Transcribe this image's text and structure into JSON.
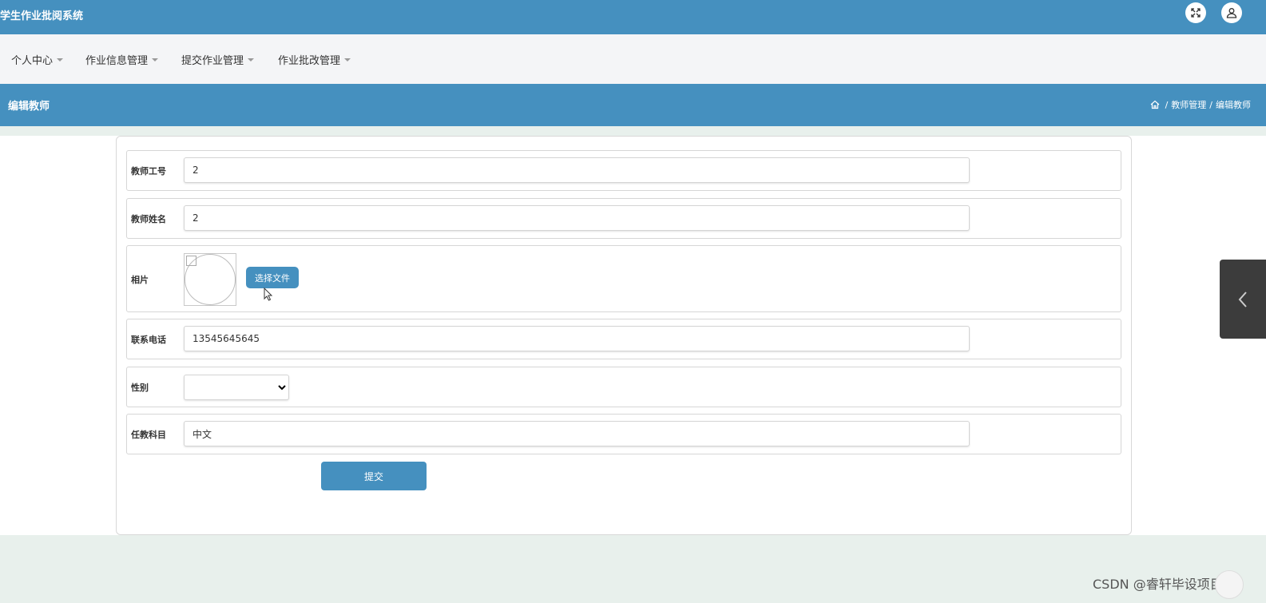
{
  "header": {
    "app_title": "学生作业批阅系统",
    "icons": [
      "fullscreen-icon",
      "user-icon"
    ]
  },
  "nav": {
    "items": [
      {
        "label": "个人中心"
      },
      {
        "label": "作业信息管理"
      },
      {
        "label": "提交作业管理"
      },
      {
        "label": "作业批改管理"
      }
    ]
  },
  "page": {
    "title": "编辑教师",
    "breadcrumb": [
      "教师管理",
      "编辑教师"
    ],
    "breadcrumb_separator": "/"
  },
  "form": {
    "teacher_id": {
      "label": "教师工号",
      "value": "2"
    },
    "teacher_name": {
      "label": "教师姓名",
      "value": "2"
    },
    "photo": {
      "label": "相片",
      "button_label": "选择文件"
    },
    "phone": {
      "label": "联系电话",
      "value": "13545645645"
    },
    "gender": {
      "label": "性别",
      "selected": ""
    },
    "subject": {
      "label": "任教科目",
      "value": "中文"
    },
    "submit_label": "提交"
  },
  "watermark": "CSDN @睿轩毕设项目",
  "colors": {
    "primary": "#4590bf",
    "nav_bg": "#f4f5f7",
    "page_bg": "#e8f0ec"
  }
}
